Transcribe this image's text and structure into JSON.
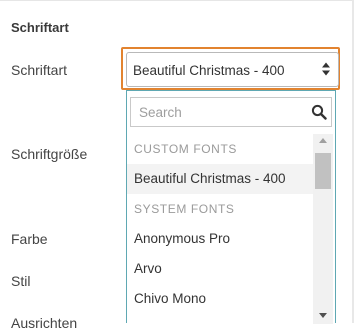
{
  "section": {
    "title": "Schriftart"
  },
  "labels": {
    "font": "Schriftart",
    "size": "Schriftgröße",
    "color": "Farbe",
    "style": "Stil",
    "align": "Ausrichten"
  },
  "font_select": {
    "value": "Beautiful Christmas - 400",
    "search_placeholder": "Search",
    "groups": [
      {
        "header": "CUSTOM FONTS",
        "options": [
          "Beautiful Christmas - 400"
        ]
      },
      {
        "header": "SYSTEM FONTS",
        "options": [
          "Anonymous Pro",
          "Arvo",
          "Chivo Mono"
        ]
      }
    ],
    "selected_option": "Beautiful Christmas - 400"
  },
  "colors": {
    "focus_outline": "#e2832f",
    "dropdown_border": "#5fa8b3"
  },
  "icons": {
    "select_arrows": "up-down-caret-icon",
    "search": "search-icon",
    "scroll_up": "scroll-up-arrow-icon",
    "scroll_down": "scroll-down-arrow-icon"
  }
}
